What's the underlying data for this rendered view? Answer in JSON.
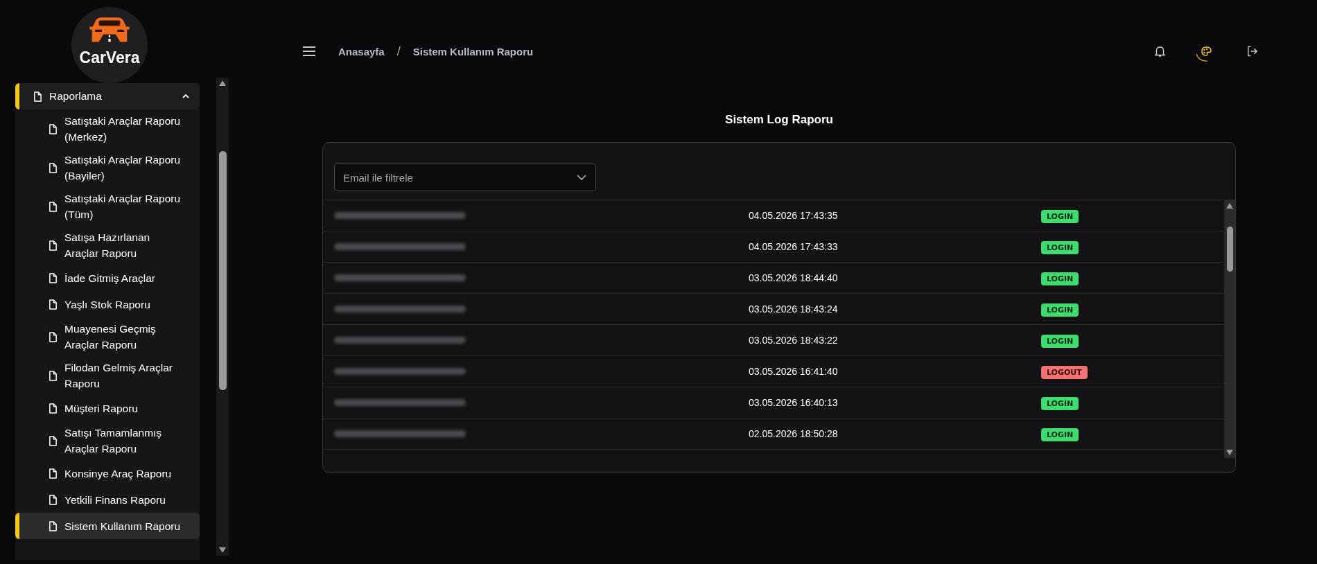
{
  "brand": {
    "name": "CarVera"
  },
  "sidebar": {
    "group": {
      "label": "Raporlama",
      "expanded": true,
      "selected": true
    },
    "items": [
      {
        "label": "Satıştaki Araçlar Raporu (Merkez)",
        "selected": false
      },
      {
        "label": "Satıştaki Araçlar Raporu (Bayiler)",
        "selected": false
      },
      {
        "label": "Satıştaki Araçlar Raporu (Tüm)",
        "selected": false
      },
      {
        "label": "Satışa Hazırlanan Araçlar Raporu",
        "selected": false
      },
      {
        "label": "İade Gitmiş Araçlar",
        "selected": false
      },
      {
        "label": "Yaşlı Stok Raporu",
        "selected": false
      },
      {
        "label": "Muayenesi Geçmiş Araçlar Raporu",
        "selected": false
      },
      {
        "label": "Filodan Gelmiş Araçlar Raporu",
        "selected": false
      },
      {
        "label": "Müşteri Raporu",
        "selected": false
      },
      {
        "label": "Satışı Tamamlanmış Araçlar Raporu",
        "selected": false
      },
      {
        "label": "Konsinye Araç Raporu",
        "selected": false
      },
      {
        "label": "Yetkili Finans Raporu",
        "selected": false
      },
      {
        "label": "Sistem Kullanım Raporu",
        "selected": true
      }
    ]
  },
  "breadcrumb": [
    "Anasayfa",
    "Sistem Kullanım Raporu"
  ],
  "breadcrumb_separator": "/",
  "page_title": "Sistem Log Raporu",
  "filter": {
    "placeholder": "Email ile filtrele"
  },
  "rows": [
    {
      "time": "04.05.2026 17:43:35",
      "action": "LOGIN",
      "kind": "login"
    },
    {
      "time": "04.05.2026 17:43:33",
      "action": "LOGIN",
      "kind": "login"
    },
    {
      "time": "03.05.2026 18:44:40",
      "action": "LOGIN",
      "kind": "login"
    },
    {
      "time": "03.05.2026 18:43:24",
      "action": "LOGIN",
      "kind": "login"
    },
    {
      "time": "03.05.2026 18:43:22",
      "action": "LOGIN",
      "kind": "login"
    },
    {
      "time": "03.05.2026 16:41:40",
      "action": "LOGOUT",
      "kind": "logout"
    },
    {
      "time": "03.05.2026 16:40:13",
      "action": "LOGIN",
      "kind": "login"
    },
    {
      "time": "02.05.2026 18:50:28",
      "action": "LOGIN",
      "kind": "login"
    }
  ]
}
